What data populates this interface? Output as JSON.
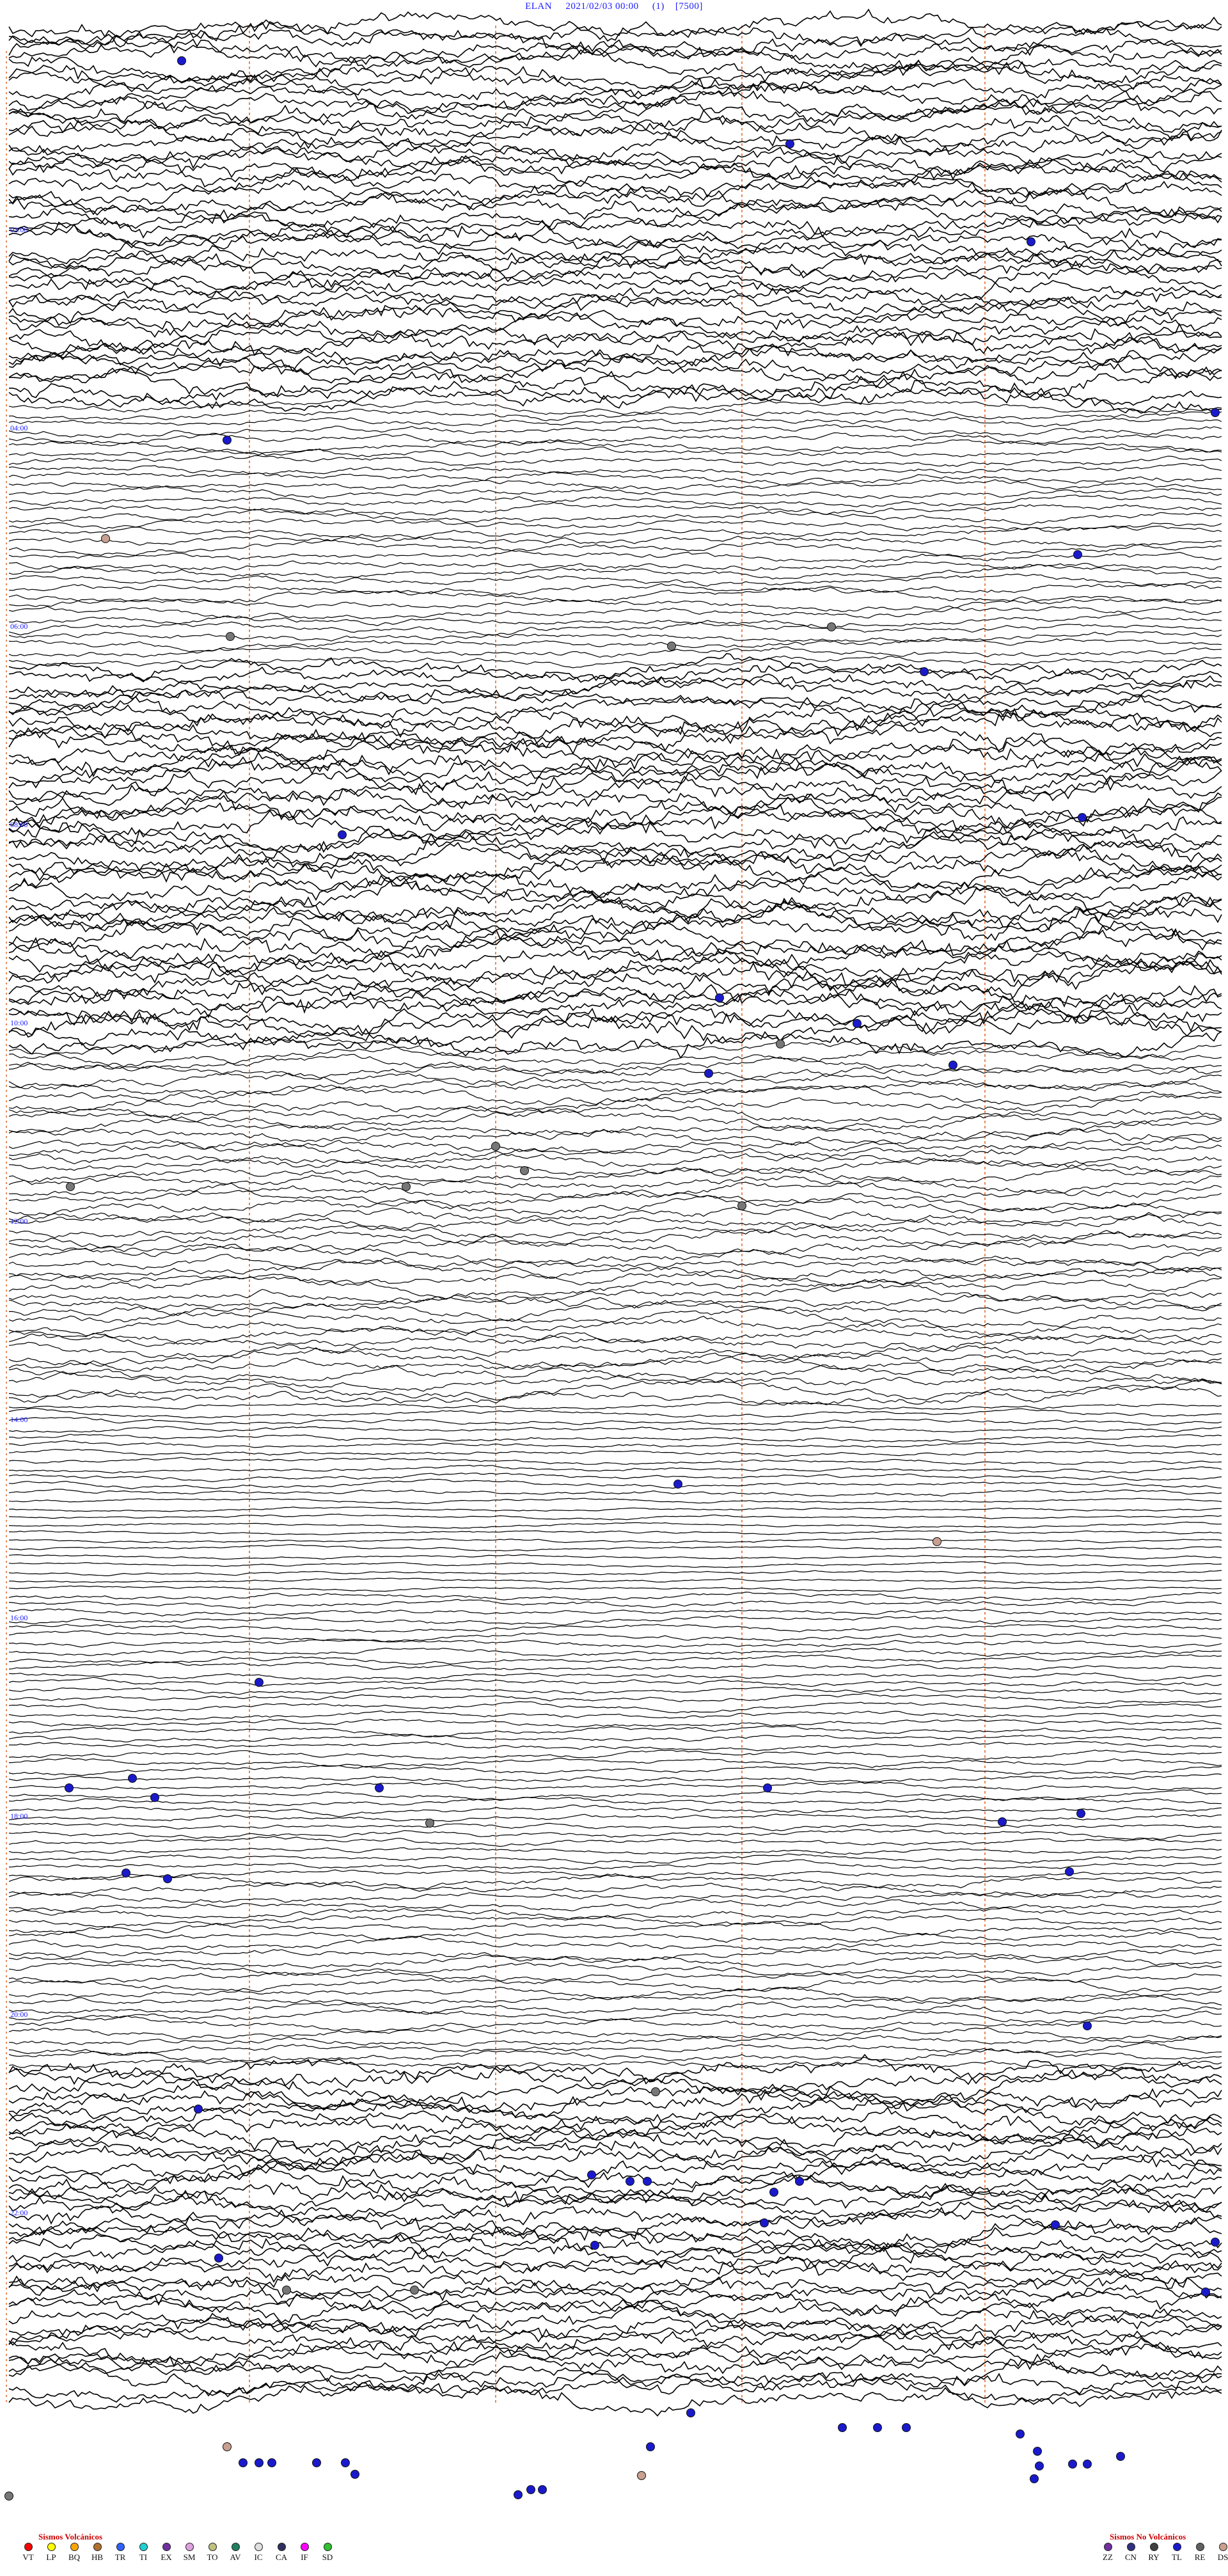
{
  "header": {
    "station": "ELAN",
    "datetime": "2021/02/03 00:00",
    "channel": "(1)",
    "scale": "[7500]"
  },
  "colors": {
    "trace": "#000000",
    "time_label": "#1a1aff",
    "hour_marker": "#e06020",
    "event_blue": "#1a1acc",
    "event_gray": "#777777",
    "event_tan": "#c8a090"
  },
  "time_labels": [
    "02:00",
    "04:00",
    "06:00",
    "08:00",
    "10:00",
    "12:00",
    "14:00",
    "16:00",
    "18:00",
    "20:00",
    "22:00"
  ],
  "legend_volcanic": {
    "title": "Sismos Volcánicos",
    "items": [
      {
        "code": "VT",
        "color": "#ff0000"
      },
      {
        "code": "LP",
        "color": "#ffff00"
      },
      {
        "code": "BQ",
        "color": "#ffa500"
      },
      {
        "code": "HB",
        "color": "#b07030"
      },
      {
        "code": "TR",
        "color": "#3060ff"
      },
      {
        "code": "TI",
        "color": "#20d0d0"
      },
      {
        "code": "EX",
        "color": "#7030a0"
      },
      {
        "code": "SM",
        "color": "#e0a0e0"
      },
      {
        "code": "TO",
        "color": "#c0c080"
      },
      {
        "code": "AV",
        "color": "#208060"
      },
      {
        "code": "IC",
        "color": "#e0e0e0"
      },
      {
        "code": "CA",
        "color": "#303060"
      },
      {
        "code": "IF",
        "color": "#ff00ff"
      },
      {
        "code": "SD",
        "color": "#30c030"
      }
    ]
  },
  "legend_nonvolcanic": {
    "title": "Sismos No Volcánicos",
    "items": [
      {
        "code": "ZZ",
        "color": "#7030a0"
      },
      {
        "code": "CN",
        "color": "#303080"
      },
      {
        "code": "RY",
        "color": "#404040"
      },
      {
        "code": "TL",
        "color": "#1a1acc"
      },
      {
        "code": "RE",
        "color": "#606060"
      },
      {
        "code": "DS",
        "color": "#c8a090"
      }
    ]
  }
}
